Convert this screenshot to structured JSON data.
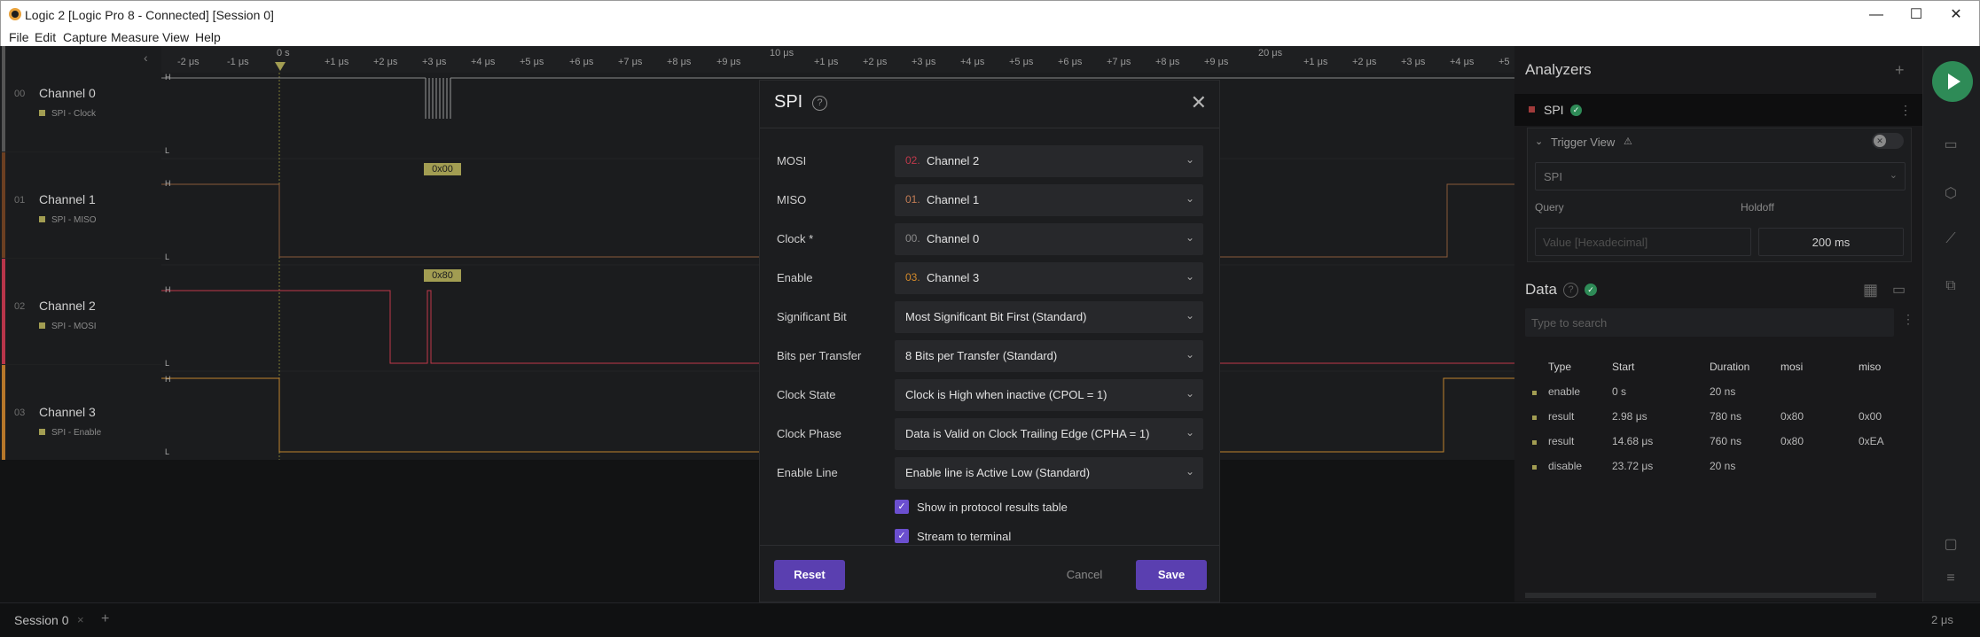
{
  "window": {
    "title": "Logic 2 [Logic Pro 8 - Connected] [Session 0]",
    "controls": {
      "minimize": "—",
      "maximize": "☐",
      "close": "✕"
    }
  },
  "menu": [
    "File",
    "Edit",
    "Capture",
    "Measure",
    "View",
    "Help"
  ],
  "timeline": {
    "ticks": [
      "-2 μs",
      "-1 μs",
      "0 s",
      "+1 μs",
      "+2 μs",
      "+3 μs",
      "+4 μs",
      "+5 μs",
      "+6 μs",
      "+7 μs",
      "+8 μs",
      "+9 μs",
      "10 μs",
      "+1 μs",
      "+2 μs",
      "+3 μs",
      "+4 μs",
      "+5 μs",
      "+6 μs",
      "+7 μs",
      "+8 μs",
      "+9 μs",
      "20 μs",
      "+1 μs",
      "+2 μs",
      "+3 μs",
      "+4 μs",
      "+5"
    ],
    "trigger_marker": "T"
  },
  "channels": [
    {
      "num": "00",
      "name": "Channel 0",
      "analyzer": "SPI - Clock",
      "color": "#6d6d6d"
    },
    {
      "num": "01",
      "name": "Channel 1",
      "analyzer": "SPI - MISO",
      "color": "#7a4a2a"
    },
    {
      "num": "02",
      "name": "Channel 2",
      "analyzer": "SPI - MOSI",
      "color": "#c0394b"
    },
    {
      "num": "03",
      "name": "Channel 3",
      "analyzer": "SPI - Enable",
      "color": "#c07f2a"
    }
  ],
  "decodes": {
    "ch1": "0x00",
    "ch2": "0x80"
  },
  "levels": {
    "high": "H",
    "low": "L"
  },
  "dialog": {
    "title": "SPI",
    "help_icon": "?",
    "close_icon": "✕",
    "fields": [
      {
        "label": "MOSI",
        "prefix": "02.",
        "value": "Channel 2",
        "prefix_color": "#c0394b"
      },
      {
        "label": "MISO",
        "prefix": "01.",
        "value": "Channel 1",
        "prefix_color": "#c27c55"
      },
      {
        "label": "Clock *",
        "prefix": "00.",
        "value": "Channel 0",
        "prefix_color": "#8a8a8a"
      },
      {
        "label": "Enable",
        "prefix": "03.",
        "value": "Channel 3",
        "prefix_color": "#d48a2b"
      },
      {
        "label": "Significant Bit",
        "prefix": "",
        "value": "Most Significant Bit First (Standard)"
      },
      {
        "label": "Bits per Transfer",
        "prefix": "",
        "value": "8 Bits per Transfer (Standard)"
      },
      {
        "label": "Clock State",
        "prefix": "",
        "value": "Clock is High when inactive (CPOL = 1)"
      },
      {
        "label": "Clock Phase",
        "prefix": "",
        "value": "Data is Valid on Clock Trailing Edge (CPHA = 1)"
      },
      {
        "label": "Enable Line",
        "prefix": "",
        "value": "Enable line is Active Low (Standard)"
      }
    ],
    "checkboxes": [
      {
        "label": "Show in protocol results table",
        "checked": true
      },
      {
        "label": "Stream to terminal",
        "checked": true
      }
    ],
    "buttons": {
      "reset": "Reset",
      "cancel": "Cancel",
      "save": "Save"
    }
  },
  "analyzers": {
    "heading": "Analyzers",
    "add_icon": "+",
    "item": "SPI",
    "trigger_view": {
      "label": "Trigger View",
      "warning_icon": "⚠",
      "select_value": "SPI",
      "query_label": "Query",
      "query_placeholder": "Value [Hexadecimal]",
      "holdoff_label": "Holdoff",
      "holdoff_value": "200 ms"
    }
  },
  "data": {
    "heading": "Data",
    "search_placeholder": "Type to search",
    "columns": [
      "Type",
      "Start",
      "Duration",
      "mosi",
      "miso"
    ],
    "rows": [
      [
        "enable",
        "0 s",
        "20 ns",
        "",
        ""
      ],
      [
        "result",
        "2.98 μs",
        "780 ns",
        "0x80",
        "0x00"
      ],
      [
        "result",
        "14.68 μs",
        "760 ns",
        "0x80",
        "0xEA"
      ],
      [
        "disable",
        "23.72 μs",
        "20 ns",
        "",
        ""
      ]
    ]
  },
  "statusbar": {
    "tab": "Session 0",
    "tab_close": "×",
    "add": "+",
    "zoom": "2 μs"
  }
}
